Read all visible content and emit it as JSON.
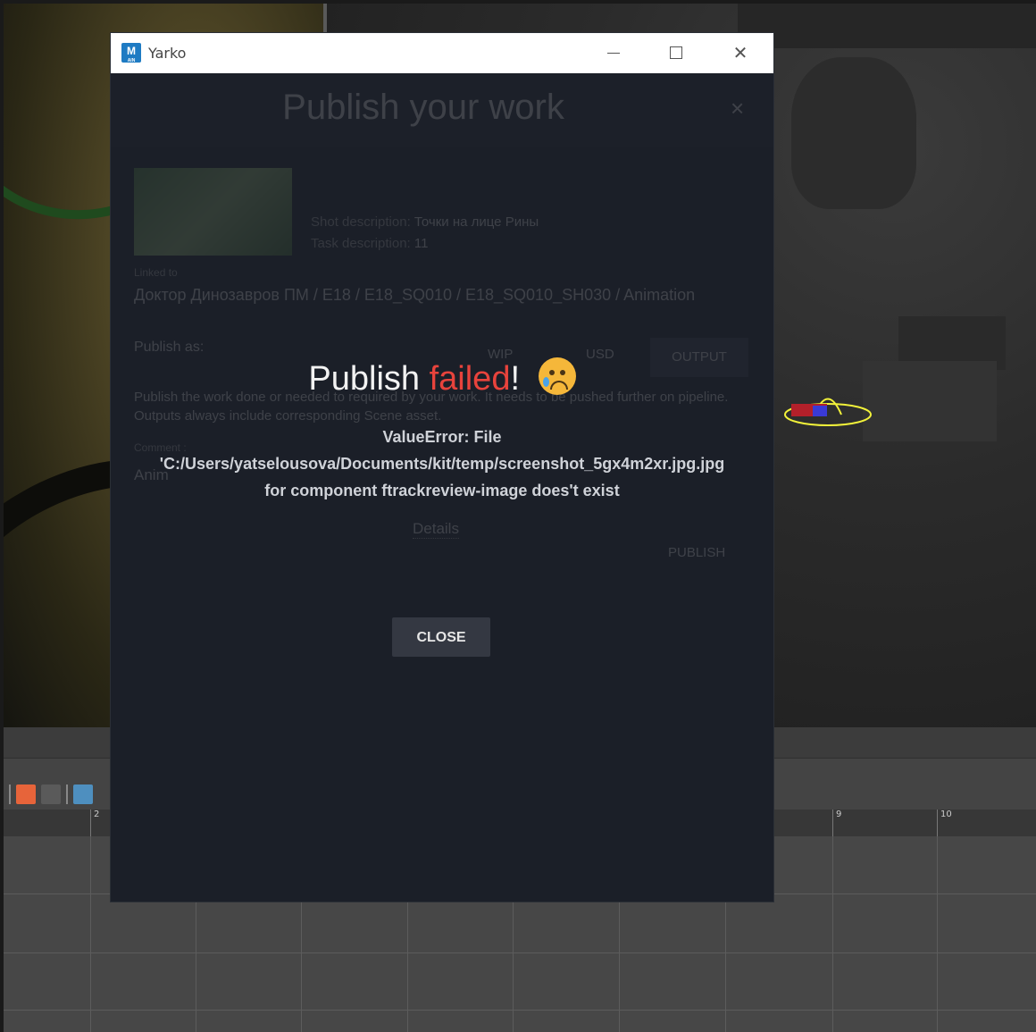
{
  "window": {
    "title": "Yarko",
    "app_icon_letter": "M",
    "app_icon_sub": "AIN"
  },
  "publish_dialog": {
    "title": "Publish your work",
    "close_glyph": "×",
    "shot_description_label": "Shot description:",
    "shot_description": "Точки на лице Рины",
    "task_description_label": "Task description:",
    "task_description": "11",
    "context_label": "Linked to",
    "context_path": "Доктор Динозавров ПМ / E18 / E18_SQ010 / E18_SQ010_SH030 / Animation",
    "publish_as_label": "Publish as:",
    "options": [
      "WIP",
      "USD"
    ],
    "output_button": "OUTPUT",
    "description": "Publish the work done or needed to required by your work. It needs to be pushed further on pipeline. Outputs always include corresponding Scene asset.",
    "comment_label": "Comment :",
    "comment_value": "Anim",
    "details_link": "Details",
    "publish_button": "PUBLISH"
  },
  "error": {
    "title_prefix": "Publish ",
    "title_highlight": "failed",
    "title_suffix": "!",
    "emoji": "crying-face",
    "message_line1": "ValueError: File",
    "message_line2": "'C:/Users/yatselousova/Documents/kit/temp/screenshot_5gx4m2xr.jpg.jpg",
    "message_line3": "for component ftrackreview-image does't exist",
    "close_button": "CLOSE",
    "highlight_color": "#e8433c"
  },
  "timeline": {
    "frame_labels": [
      "2",
      "9",
      "10"
    ]
  }
}
